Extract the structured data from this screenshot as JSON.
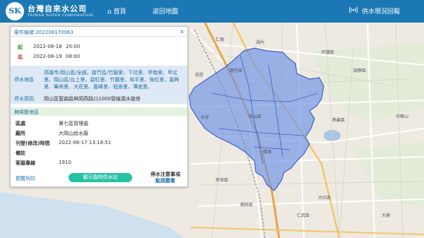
{
  "header": {
    "logo_mark": "SK",
    "logo_title": "台灣自來水公司",
    "logo_subtitle": "TAIWAN WATER CORPORATION",
    "nav_home": "首頁",
    "nav_back": "返回地圖",
    "nav_status": "供水現況回報",
    "home_icon": "home-icon",
    "signal_icon": "broadcast-icon"
  },
  "panel": {
    "case_label": "案件編號:",
    "case_no": "202208170063",
    "close": "x",
    "start_tag": "起",
    "start_date": "2022-08-18",
    "start_time": "20:00",
    "end_tag": "迄",
    "end_date": "2022-08-19",
    "end_time": "08:00",
    "area_label": "停水地區",
    "area_text": "高雄市/岡山區/全部。路竹區/竹園里、下坑里、甲南里、甲北里。岡山區/台上里、碧紅里、竹園里、和平里、後紅里、嘉興里、華崗里、大莊里、嘉峰里、程香里、潭底里。",
    "reason_label": "停水原因",
    "reason_text": "岡山區聖森路與岡燕路口1000管線漏水搶修",
    "section_title": "無降壓地區",
    "rows": [
      {
        "key": "區處",
        "value": "第七區管理處"
      },
      {
        "key": "廠所",
        "value": "大岡山給水廠"
      },
      {
        "key": "刊登(修改)時間",
        "value": "2022-08-17 13:18:51"
      },
      {
        "key": "備註",
        "value": ""
      },
      {
        "key": "客服專線",
        "value": "1910"
      }
    ],
    "preview_print": "預覽列印",
    "temp_supply_button": "顯示臨時供水站",
    "notice_title": "停水注意事項",
    "notice_link": "點我觀看"
  },
  "map": {
    "labels": [
      "仁德",
      "湖內",
      "阿蓮區",
      "田寮區",
      "岡山區",
      "燕巢區",
      "橋頭",
      "梓官區",
      "楠梓區",
      "中寮山",
      "大社區",
      "永安",
      "茄萣",
      "路竹區",
      "大樹",
      "仁武區"
    ],
    "colors": {
      "highlight_fill": "#6f95e4",
      "highlight_stroke": "#3f5fc8",
      "land": "#eeeae2",
      "highway": "#e8a44a",
      "road": "#ffffff"
    }
  }
}
